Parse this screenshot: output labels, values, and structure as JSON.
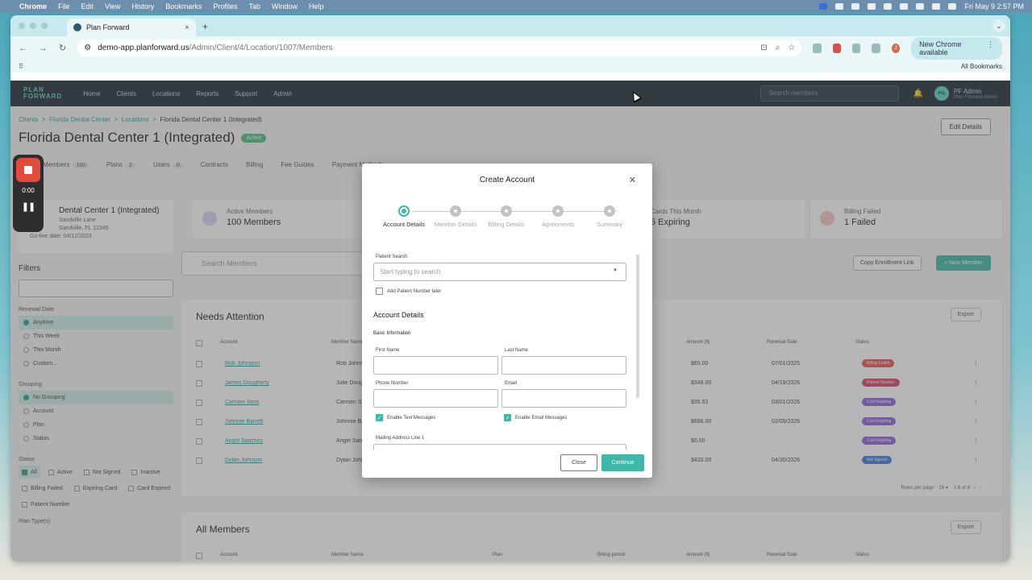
{
  "macbar": {
    "app": "Chrome",
    "menus": [
      "File",
      "Edit",
      "View",
      "History",
      "Bookmarks",
      "Profiles",
      "Tab",
      "Window",
      "Help"
    ],
    "clock": "Fri May 9  2:57 PM"
  },
  "browser": {
    "tab_title": "Plan Forward",
    "url_host": "demo-app.planforward.us",
    "url_path": "/Admin/Client/4/Location/1007/Members",
    "new_chrome": "New Chrome available",
    "all_bookmarks": "All Bookmarks",
    "avatar_letter": "J"
  },
  "app": {
    "logo_line1": "PLAN",
    "logo_line2": "FORWARD",
    "nav": [
      "Home",
      "Clients",
      "Locations",
      "Reports",
      "Support",
      "Admin"
    ],
    "search_placeholder": "Search members",
    "user_name": "PF Admin",
    "user_sub": "Plan Forward Admin",
    "user_initials": "PA"
  },
  "page": {
    "breadcrumbs": [
      "Clients",
      "Florida Dental Center",
      "Locations",
      "Florida Dental Center 1 (Integrated)"
    ],
    "title": "Florida Dental Center 1 (Integrated)",
    "status": "Active",
    "edit_button": "Edit Details",
    "tabs": [
      {
        "label": "Members",
        "count": "100"
      },
      {
        "label": "Plans",
        "count": "2"
      },
      {
        "label": "Users",
        "count": "0"
      },
      {
        "label": "Contracts",
        "count": ""
      },
      {
        "label": "Billing",
        "count": ""
      },
      {
        "label": "Fee Guides",
        "count": ""
      },
      {
        "label": "Payment Methods",
        "count": ""
      }
    ],
    "location_card": {
      "name": "Dental Center 1 (Integrated)",
      "line1": "Sandville Lane",
      "line2": "Sandville, FL 12345",
      "golive": "Go-live date: 04/12/2023"
    },
    "stats": [
      {
        "label": "Active Members",
        "value": "100 Members"
      },
      {
        "label": "Cards This Month",
        "value": "5 Expiring"
      },
      {
        "label": "Billing Failed",
        "value": "1 Failed"
      }
    ],
    "member_search": "Search Members",
    "copy_link": "Copy Enrollment Link",
    "new_member": "+ New Member"
  },
  "filters": {
    "title": "Filters",
    "renewal_label": "Renewal Date",
    "renewal": [
      "Anytime",
      "This Week",
      "This Month",
      "Custom..."
    ],
    "grouping_label": "Grouping",
    "grouping": [
      "No Grouping",
      "Account",
      "Plan",
      "Status"
    ],
    "status_label": "Status",
    "status": [
      "All",
      "Active",
      "Not Signed",
      "Inactive",
      "Billing Failed",
      "Expiring Card",
      "Card Expired",
      "Patient Number"
    ],
    "plan_types_label": "Plan Type(s)"
  },
  "needs_attention": {
    "title": "Needs Attention",
    "export": "Export",
    "headers": [
      "Account",
      "Member Name",
      "Amount ($)",
      "Renewal Date",
      "Status"
    ],
    "rows": [
      {
        "account": "Rob Johnston",
        "member": "Rob Johnston",
        "amount": "$65.00",
        "date": "07/01/2025",
        "status": "Billing Failed",
        "color": "#e05757"
      },
      {
        "account": "James Dougherty",
        "member": "Julie Dougherty",
        "amount": "$348.00",
        "date": "04/19/2026",
        "status": "Patient Number",
        "color": "#d9446b"
      },
      {
        "account": "Carmen Sims",
        "member": "Carmen Sims",
        "amount": "$35.92",
        "date": "03/01/2026",
        "status": "Card Expiring",
        "color": "#8a62d6"
      },
      {
        "account": "Johnnie Barrett",
        "member": "Johnnie Barrett",
        "amount": "$696.00",
        "date": "02/05/2026",
        "status": "Card Expiring",
        "color": "#8a62d6"
      },
      {
        "account": "Angel Sanchez",
        "member": "Angel Sanchez",
        "amount": "$0.00",
        "date": "",
        "status": "Card Expiring",
        "color": "#8a62d6"
      },
      {
        "account": "Dylan Johnson",
        "member": "Dylan Johnson",
        "amount": "$420.00",
        "date": "04/30/2026",
        "status": "Not Signed",
        "color": "#3f7be0"
      }
    ],
    "rows_per_page": "Rows per page:",
    "rows_value": "15",
    "page_range": "1-6 of 6"
  },
  "all_members": {
    "title": "All Members",
    "export": "Export",
    "headers": [
      "Account",
      "Member Name",
      "Plan",
      "Billing period",
      "Amount ($)",
      "Renewal Date",
      "Status"
    ]
  },
  "recorder": {
    "time": "0:00"
  },
  "modal": {
    "title": "Create Account",
    "steps": [
      "Account Details",
      "Member Details",
      "Billing Details",
      "Agreements",
      "Summary"
    ],
    "patient_search_label": "Patient Search",
    "patient_search_placeholder": "Start typing to search",
    "add_patient_later": "Add Patient Number later",
    "section_title": "Account Details",
    "basic_info": "Basic Information",
    "first_name": "First Name",
    "last_name": "Last Name",
    "phone": "Phone Number",
    "email": "Email",
    "enable_text": "Enable Text Messages",
    "enable_email": "Enable Email Messages",
    "mailing1": "Mailing Address Line 1",
    "close": "Close",
    "continue": "Continue"
  }
}
